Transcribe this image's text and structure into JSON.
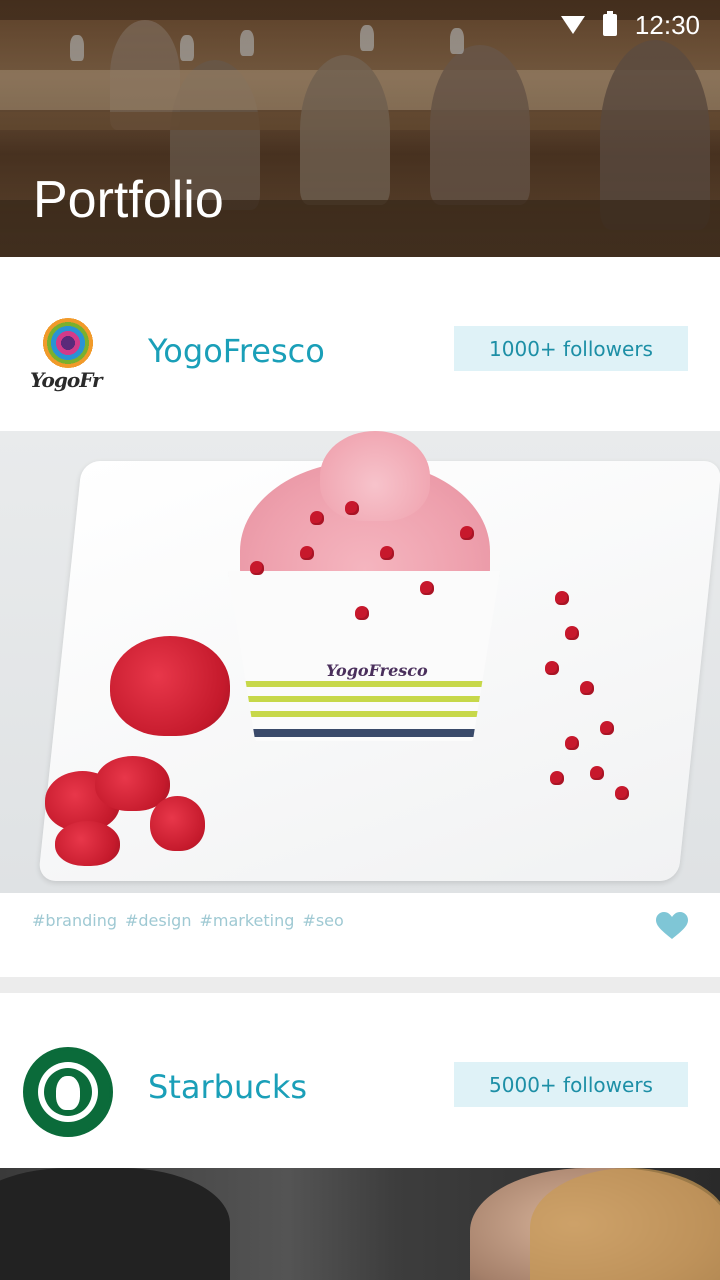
{
  "status_bar": {
    "time": "12:30"
  },
  "header": {
    "title": "Portfolio"
  },
  "portfolio": [
    {
      "brand": "YogoFresco",
      "followers": "1000+ followers",
      "logo_text": "YogoFr",
      "product_label": "YogoFresco",
      "tags": [
        "#branding",
        "#design",
        "#marketing",
        "#seo"
      ],
      "liked": true
    },
    {
      "brand": "Starbucks",
      "followers": "5000+ followers"
    }
  ],
  "colors": {
    "accent": "#1a9fb8",
    "follower_badge_bg": "#dff2f7",
    "tag": "#9fc9d3",
    "heart": "#7fc6d6",
    "separator": "#ececec"
  }
}
